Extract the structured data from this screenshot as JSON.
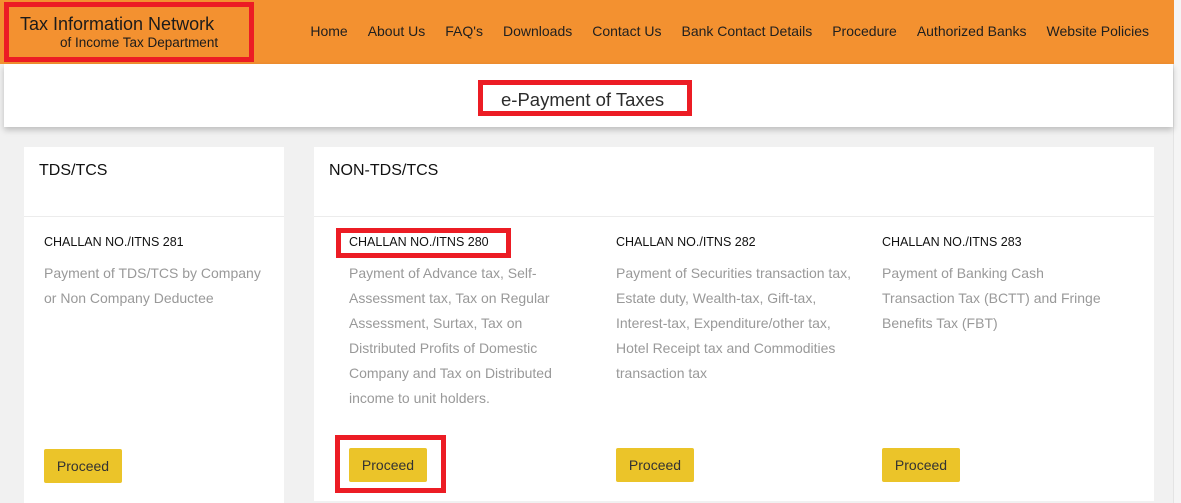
{
  "header": {
    "brand_title": "Tax Information Network",
    "brand_subtitle": "of Income Tax Department",
    "nav": [
      "Home",
      "About Us",
      "FAQ's",
      "Downloads",
      "Contact Us",
      "Bank Contact Details",
      "Procedure",
      "Authorized Banks",
      "Website Policies"
    ]
  },
  "banner": {
    "title": "e-Payment of Taxes"
  },
  "sections": {
    "tds": {
      "title": "TDS/TCS",
      "items": [
        {
          "code": "CHALLAN NO./ITNS 281",
          "description": "Payment of TDS/TCS by Company or Non Company Deductee",
          "button": "Proceed"
        }
      ]
    },
    "non_tds": {
      "title": "NON-TDS/TCS",
      "items": [
        {
          "code": "CHALLAN NO./ITNS 280",
          "description": "Payment of Advance tax, Self-Assessment tax, Tax on Regular Assessment, Surtax, Tax on Distributed Profits of Domestic Company and Tax on Distributed income to unit holders.",
          "button": "Proceed",
          "highlighted": true
        },
        {
          "code": "CHALLAN NO./ITNS 282",
          "description": "Payment of Securities transaction tax, Estate duty, Wealth-tax, Gift-tax, Interest-tax, Expenditure/other tax, Hotel Receipt tax and Commodities transaction tax",
          "button": "Proceed"
        },
        {
          "code": "CHALLAN NO./ITNS 283",
          "description": "Payment of Banking Cash Transaction Tax (BCTT) and Fringe Benefits Tax (FBT)",
          "button": "Proceed"
        }
      ]
    }
  },
  "colors": {
    "header_bg": "#f39130",
    "highlight": "#ec1c24",
    "button_bg": "#ebc429",
    "muted_text": "#999999"
  }
}
